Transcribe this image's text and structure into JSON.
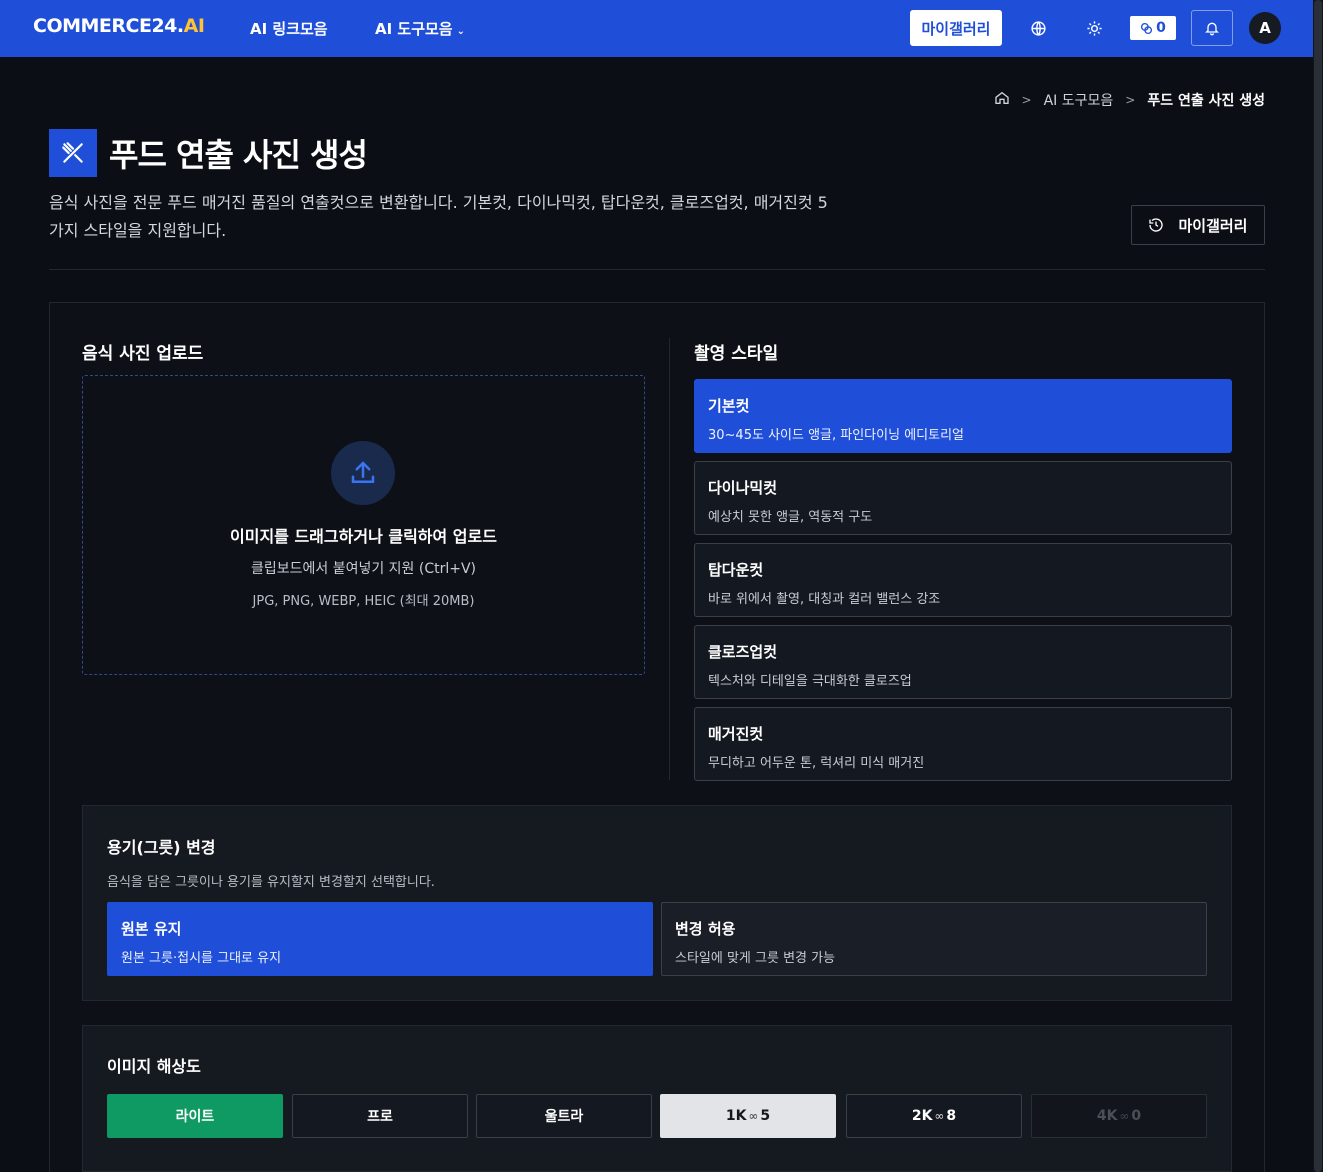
{
  "header": {
    "logo_main": "COMMERCE24.",
    "logo_accent": "AI",
    "nav_links": "AI 링크모음",
    "nav_tools": "AI 도구모음",
    "nav_tools_chevron": "⌄",
    "gallery_button": "마이갤러리",
    "credit_count": "0",
    "avatar_letter": "A"
  },
  "breadcrumb": {
    "level1": "AI 도구모음",
    "current": "푸드 연출 사진 생성"
  },
  "page": {
    "title": "푸드 연출 사진 생성",
    "description": "음식 사진을 전문 푸드 매거진 품질의 연출컷으로 변환합니다. 기본컷, 다이나믹컷, 탑다운컷, 클로즈업컷, 매거진컷 5가지 스타일을 지원합니다.",
    "gallery_button": "마이갤러리"
  },
  "upload": {
    "label": "음식 사진 업로드",
    "title": "이미지를 드래그하거나 클릭하여 업로드",
    "subtitle": "클립보드에서 붙여넣기 지원 (Ctrl+V)",
    "formats": "JPG, PNG, WEBP, HEIC (최대 20MB)"
  },
  "styles": {
    "label": "촬영 스타일",
    "items": [
      {
        "title": "기본컷",
        "desc": "30~45도 사이드 앵글, 파인다이닝 에디토리얼"
      },
      {
        "title": "다이나믹컷",
        "desc": "예상치 못한 앵글, 역동적 구도"
      },
      {
        "title": "탑다운컷",
        "desc": "바로 위에서 촬영, 대칭과 컬러 밸런스 강조"
      },
      {
        "title": "클로즈업컷",
        "desc": "텍스처와 디테일을 극대화한 클로즈업"
      },
      {
        "title": "매거진컷",
        "desc": "무디하고 어두운 톤, 럭셔리 미식 매거진"
      }
    ]
  },
  "vessel": {
    "title": "용기(그릇) 변경",
    "desc": "음식을 담은 그릇이나 용기를 유지할지 변경할지 선택합니다.",
    "options": [
      {
        "title": "원본 유지",
        "desc": "원본 그릇·접시를 그대로 유지"
      },
      {
        "title": "변경 허용",
        "desc": "스타일에 맞게 그릇 변경 가능"
      }
    ]
  },
  "resolution": {
    "title": "이미지 해상도",
    "buttons": [
      {
        "label": "라이트"
      },
      {
        "label": "프로"
      },
      {
        "label": "울트라"
      },
      {
        "label": "1K",
        "cost": "5"
      },
      {
        "label": "2K",
        "cost": "8"
      },
      {
        "label": "4K",
        "cost": "0"
      }
    ]
  },
  "colors": {
    "primary": "#1f4fd8",
    "background": "#0b0e14",
    "green": "#0f9a63",
    "logo_accent": "#ffc234"
  }
}
